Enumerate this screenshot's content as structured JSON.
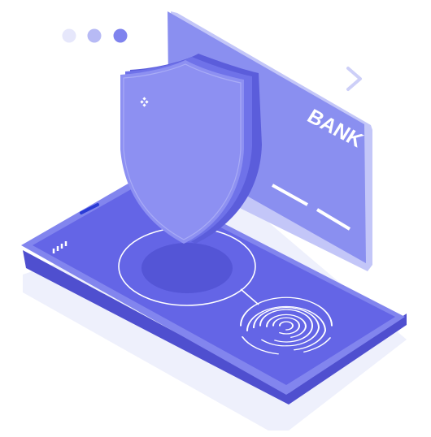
{
  "card": {
    "label": "BANK"
  },
  "colors": {
    "background": "#ffffff",
    "phone_screen": "#6465e6",
    "phone_edge": "#4f4fcf",
    "card": "#8a8ff0",
    "shield_front": "#8d90f2",
    "shield_side": "#5b5ddb",
    "floor_shadow": "#eef0fc",
    "accent_line": "#ffffff"
  },
  "icons": {
    "pager": "pagination-dots-icon",
    "next": "chevron-right-icon",
    "sparkle": "sparkle-icon",
    "fingerprint": "fingerprint-icon",
    "signal": "signal-bars-icon"
  },
  "pager": {
    "total": 3,
    "active_index": 2
  }
}
